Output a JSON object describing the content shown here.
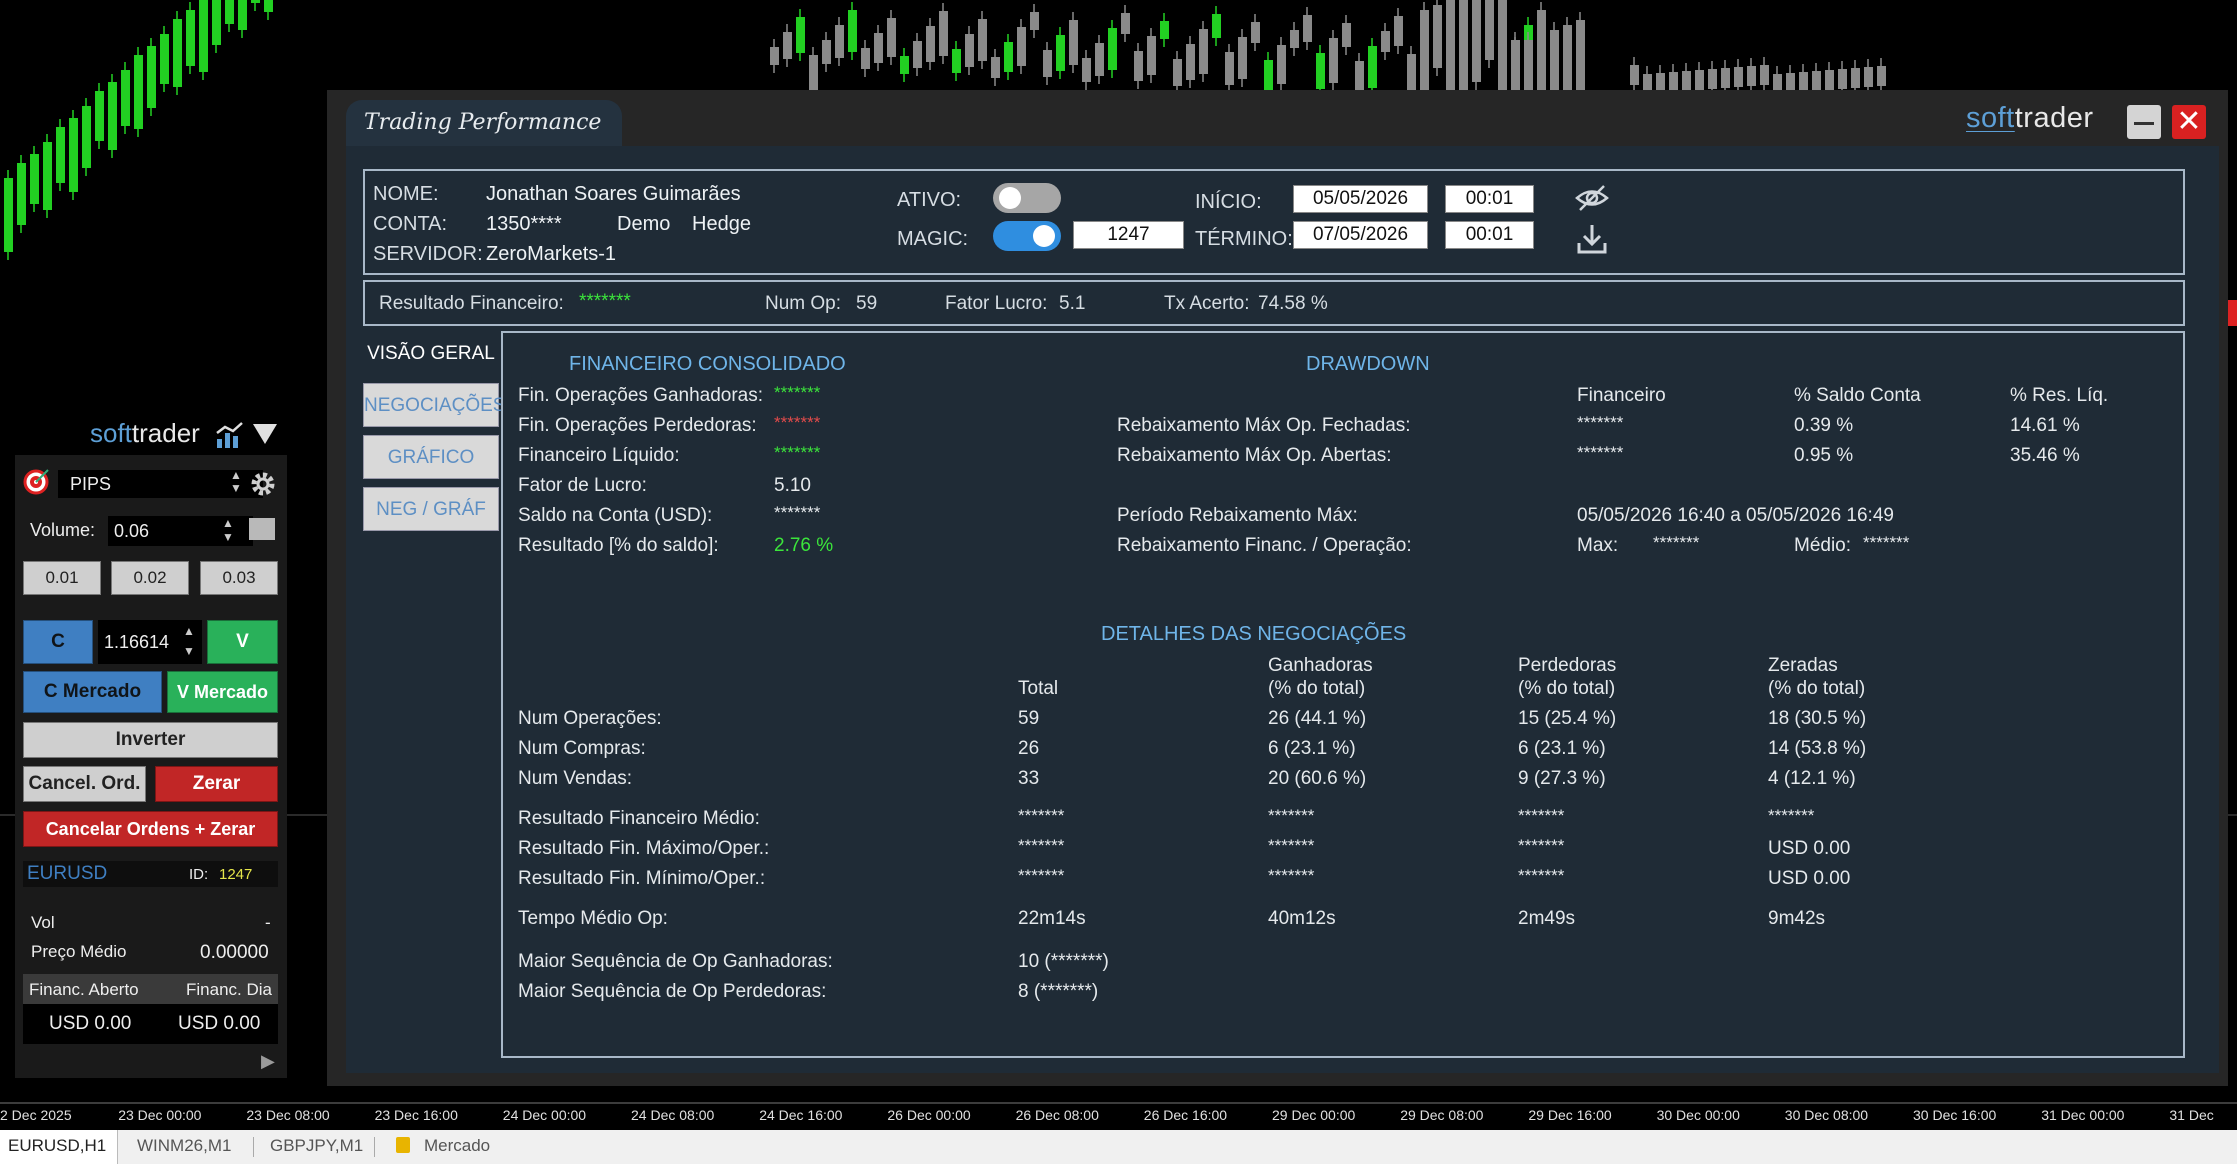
{
  "window": {
    "title": "Trading Performance",
    "brand_soft": "soft",
    "brand_trader": "trader",
    "minimize_icon": "minimize-icon",
    "close_label": "✕"
  },
  "account": {
    "name_label": "NOME:",
    "name": "Jonathan Soares Guimarães",
    "account_label": "CONTA:",
    "account": "1350****",
    "account_type": "Demo",
    "margin_mode": "Hedge",
    "server_label": "SERVIDOR:",
    "server": "ZeroMarkets-1",
    "ativo_label": "ATIVO:",
    "magic_label": "MAGIC:",
    "magic_value": "1247",
    "inicio_label": "INÍCIO:",
    "inicio_date": "05/05/2026",
    "inicio_time": "00:01",
    "termino_label": "TÉRMINO:",
    "termino_date": "07/05/2026",
    "termino_time": "00:01"
  },
  "summary": {
    "resultado_label": "Resultado Financeiro:",
    "resultado_value": "*******",
    "numop_label": "Num Op:",
    "numop_value": "59",
    "fator_label": "Fator Lucro:",
    "fator_value": "5.1",
    "tx_label": "Tx Acerto:",
    "tx_value": "74.58 %"
  },
  "nav": [
    "VISÃO GERAL",
    "NEGOCIAÇÕES",
    "GRÁFICO",
    "NEG / GRÁF"
  ],
  "financeiro": {
    "title": "FINANCEIRO CONSOLIDADO",
    "rows": [
      {
        "label": "Fin. Operações Ganhadoras:",
        "value": "*******"
      },
      {
        "label": "Fin. Operações Perdedoras:",
        "value": "*******"
      },
      {
        "label": "Financeiro Líquido:",
        "value": "*******"
      },
      {
        "label": "Fator de Lucro:",
        "value": "5.10"
      },
      {
        "label": "Saldo na Conta (USD):",
        "value": "*******"
      },
      {
        "label": "Resultado [% do saldo]:",
        "value": "2.76 %"
      }
    ]
  },
  "drawdown": {
    "title": "DRAWDOWN",
    "col_fin": "Financeiro",
    "col_saldo": "% Saldo Conta",
    "col_res": "% Res. Líq.",
    "fechadas_label": "Rebaixamento Máx Op. Fechadas:",
    "fechadas": [
      "*******",
      "0.39 %",
      "14.61 %"
    ],
    "abertas_label": "Rebaixamento Máx Op. Abertas:",
    "abertas": [
      "*******",
      "0.95 %",
      "35.46 %"
    ],
    "periodo_label": "Período Rebaixamento Máx:",
    "periodo_value": "05/05/2026 16:40 a 05/05/2026 16:49",
    "oper_label": "Rebaixamento Financ. / Operação:",
    "max_label": "Max:",
    "max_value": "*******",
    "medio_label": "Médio:",
    "medio_value": "*******"
  },
  "detalhes": {
    "title": "DETALHES DAS NEGOCIAÇÕES",
    "headers": {
      "total": "Total",
      "ganhadoras": "Ganhadoras",
      "perdedoras": "Perdedoras",
      "zeradas": "Zeradas",
      "pct": "(% do total)"
    },
    "rows": [
      {
        "label": "Num Operações:",
        "cells": [
          "59",
          "26 (44.1 %)",
          "15 (25.4 %)",
          "18 (30.5 %)"
        ]
      },
      {
        "label": "Num Compras:",
        "cells": [
          "26",
          "6 (23.1 %)",
          "6 (23.1 %)",
          "14 (53.8 %)"
        ]
      },
      {
        "label": "Num Vendas:",
        "cells": [
          "33",
          "20 (60.6 %)",
          "9 (27.3 %)",
          "4 (12.1 %)"
        ]
      },
      {
        "label": "Resultado Financeiro Médio:",
        "cells": [
          "*******",
          "*******",
          "*******",
          "*******"
        ]
      },
      {
        "label": "Resultado Fin. Máximo/Oper.:",
        "cells": [
          "*******",
          "*******",
          "*******",
          "USD 0.00"
        ]
      },
      {
        "label": "Resultado Fin. Mínimo/Oper.:",
        "cells": [
          "*******",
          "*******",
          "*******",
          "USD 0.00"
        ]
      },
      {
        "label": "Tempo Médio Op:",
        "cells": [
          "22m14s",
          "40m12s",
          "2m49s",
          "9m42s"
        ]
      },
      {
        "label": "Maior Sequência de Op Ganhadoras:",
        "cells": [
          "10 (*******)"
        ]
      },
      {
        "label": "Maior Sequência de Op Perdedoras:",
        "cells": [
          "8 (*******)"
        ]
      }
    ]
  },
  "softtrader_panel": {
    "brand_soft": "soft",
    "brand_trader": "trader",
    "mode": "PIPS",
    "volume_label": "Volume:",
    "volume": "0.06",
    "presets": [
      "0.01",
      "0.02",
      "0.03"
    ],
    "buy": "C",
    "price": "1.16614",
    "sell": "V",
    "buy_market": "C Mercado",
    "sell_market": "V Mercado",
    "invert": "Inverter",
    "cancel_orders": "Cancel. Ord.",
    "zero": "Zerar",
    "cancel_zero": "Cancelar Ordens + Zerar",
    "symbol": "EURUSD",
    "id_label": "ID:",
    "id_value": "1247",
    "vol_label": "Vol",
    "vol_value": "-",
    "preco_label": "Preço Médio",
    "preco_value": "0.00000",
    "fin_aberto_label": "Financ. Aberto",
    "fin_dia_label": "Financ. Dia",
    "fin_aberto": "USD 0.00",
    "fin_dia": "USD 0.00"
  },
  "time_axis": [
    "2 Dec 2025",
    "23 Dec 00:00",
    "23 Dec 08:00",
    "23 Dec 16:00",
    "24 Dec 00:00",
    "24 Dec 08:00",
    "24 Dec 16:00",
    "26 Dec 00:00",
    "26 Dec 08:00",
    "26 Dec 16:00",
    "29 Dec 00:00",
    "29 Dec 08:00",
    "29 Dec 16:00",
    "30 Dec 00:00",
    "30 Dec 08:00",
    "30 Dec 16:00",
    "31 Dec 00:00",
    "31 Dec"
  ],
  "chart_tabs": [
    "EURUSD,H1",
    "WINM26,M1",
    "GBPJPY,M1",
    "Mercado"
  ],
  "colors": {
    "up": "#22d022",
    "down": "#8a8a8a",
    "accent": "#6fb5e9",
    "positive": "#3be53b",
    "negative": "#e24b4b"
  }
}
